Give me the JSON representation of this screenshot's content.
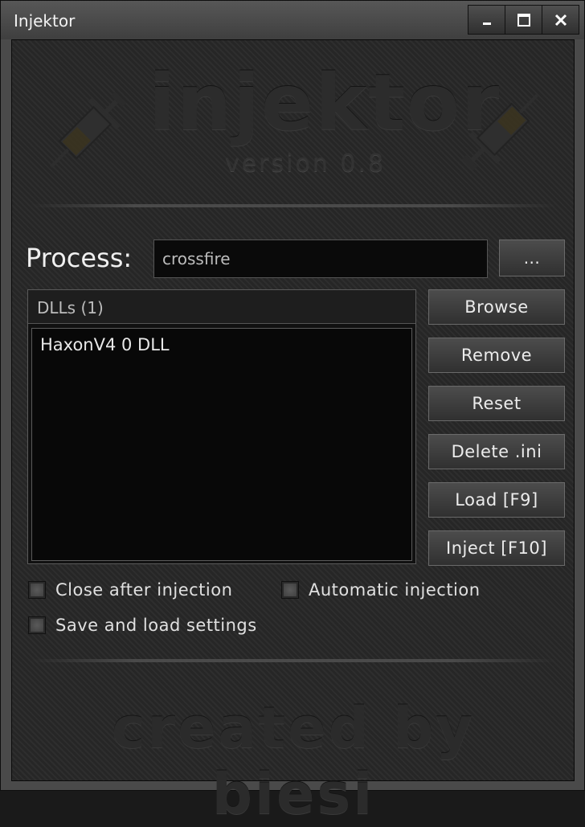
{
  "window": {
    "title": "Injektor"
  },
  "logo": {
    "name": "injektor",
    "version": "version 0.8",
    "credit": "created by biesi"
  },
  "process": {
    "label": "Process:",
    "value": "crossfire",
    "browse_button": "..."
  },
  "dlls": {
    "header": "DLLs (1)",
    "items": [
      "HaxonV4 0 DLL"
    ]
  },
  "buttons": {
    "browse": "Browse",
    "remove": "Remove",
    "reset": "Reset",
    "delete_ini": "Delete .ini",
    "load": "Load [F9]",
    "inject": "Inject [F10]"
  },
  "options": {
    "close_after_injection": "Close after injection",
    "automatic_injection": "Automatic injection",
    "save_and_load_settings": "Save and load settings"
  }
}
